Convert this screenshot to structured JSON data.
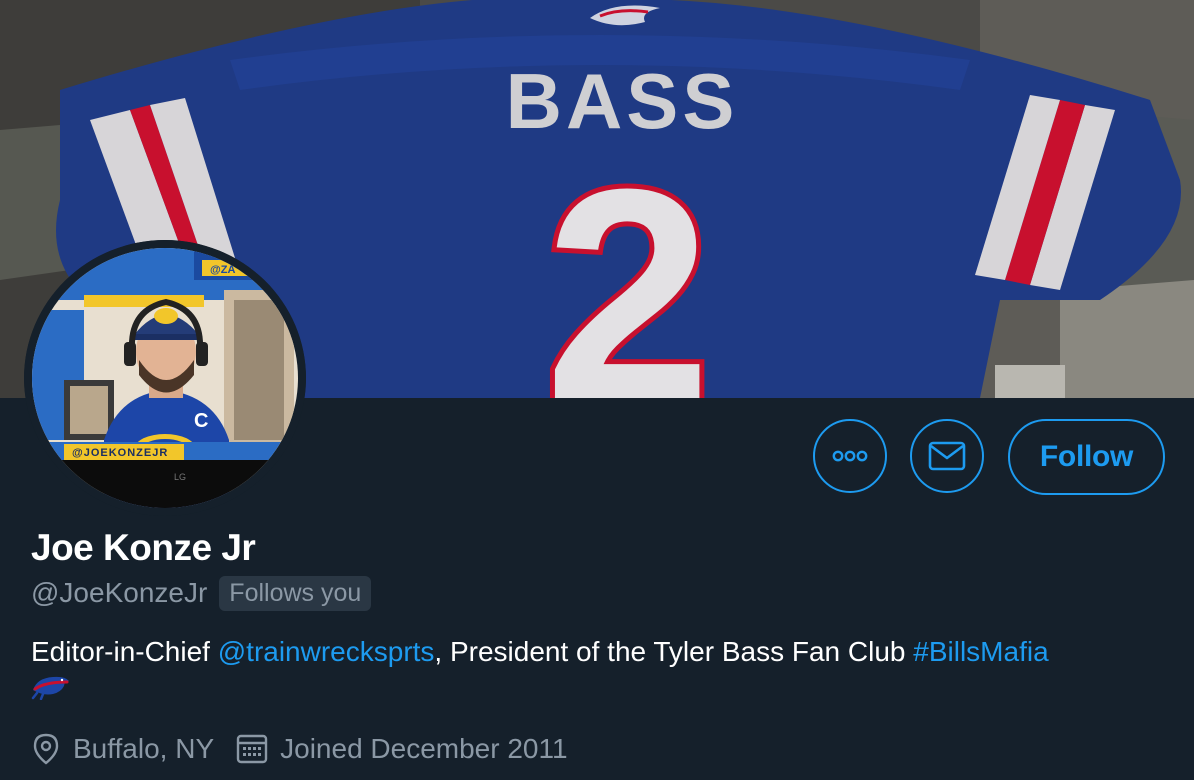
{
  "profile": {
    "display_name": "Joe Konze Jr",
    "handle": "@JoeKonzeJr",
    "follows_you": "Follows you",
    "bio": {
      "part1": "Editor-in-Chief ",
      "mention": "@trainwrecksprts",
      "part2": ", President of the Tyler Bass Fan Club ",
      "hashtag": "#BillsMafia",
      "emoji": "buffalo-bills-logo"
    },
    "location": "Buffalo, NY",
    "joined": "Joined December 2011"
  },
  "banner": {
    "jersey_name": "BASS",
    "jersey_number": "2"
  },
  "avatar": {
    "banner_text": "@JOEKONZEJR",
    "corner_text": "@ZA",
    "cap_letter": "C",
    "monitor_brand": "LG"
  },
  "actions": {
    "more_icon": "more-icon",
    "message_icon": "envelope-icon",
    "follow_label": "Follow"
  },
  "colors": {
    "background": "#15202b",
    "accent": "#1d9bf0",
    "secondary_text": "#8b98a5",
    "jersey_blue": "#1d3f8f",
    "jersey_red": "#c8102e"
  }
}
